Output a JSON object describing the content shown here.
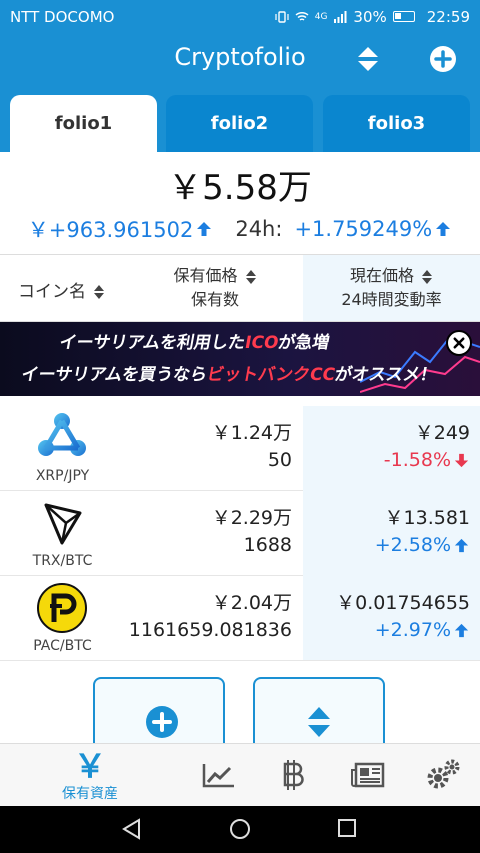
{
  "status_bar": {
    "carrier": "NTT DOCOMO",
    "battery": "30%",
    "time": "22:59",
    "network": "4G"
  },
  "app_bar": {
    "title": "Cryptofolio",
    "sort_icon": "sort-updown-icon",
    "add_icon": "add-circle-icon"
  },
  "tabs": [
    {
      "label": "folio1",
      "active": true
    },
    {
      "label": "folio2",
      "active": false
    },
    {
      "label": "folio3",
      "active": false
    }
  ],
  "summary": {
    "total": "￥5.58万",
    "change_amount": "￥+963.961502",
    "period_label": "24h:",
    "change_percent": "+1.759249%"
  },
  "columns": {
    "coin_name": "コイン名",
    "holding_value": "保有価格",
    "holding_qty": "保有数",
    "current_price": "現在価格",
    "change_24h": "24時間変動率"
  },
  "banner": {
    "line1_a": "イーサリアムを利用した",
    "line1_hl": "ICO",
    "line1_b": "が急増",
    "line2_a": "イーサリアムを買うなら",
    "line2_hl": "ビットバンクCC",
    "line2_b": "がオススメ！"
  },
  "rows": [
    {
      "pair": "XRP/JPY",
      "value": "￥1.24万",
      "quantity": "50",
      "price": "￥249",
      "change": "-1.58%",
      "direction": "down"
    },
    {
      "pair": "TRX/BTC",
      "value": "￥2.29万",
      "quantity": "1688",
      "price": "￥13.581",
      "change": "+2.58%",
      "direction": "up"
    },
    {
      "pair": "PAC/BTC",
      "value": "￥2.04万",
      "quantity": "1161659.081836",
      "price": "￥0.01754655",
      "change": "+2.97%",
      "direction": "up"
    }
  ],
  "bottom_nav": {
    "active_label": "保有資産",
    "active_glyph": "￥"
  },
  "colors": {
    "primary": "#1a90d3",
    "positive": "#1c7ee0",
    "negative": "#e8384f"
  }
}
